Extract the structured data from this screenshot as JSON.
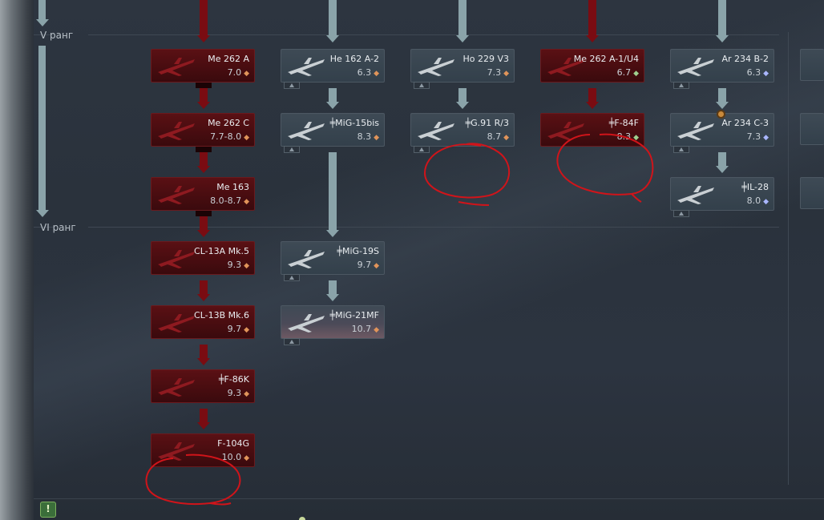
{
  "ranks": [
    {
      "label": "V ранг"
    },
    {
      "label": "VI ранг"
    }
  ],
  "columns": [
    {
      "vehicles": [
        {
          "name": "Me 262 A",
          "br": "7.0",
          "style": "red",
          "br_color": "orange"
        },
        {
          "name": "Me 262 C",
          "br": "7.7-8.0",
          "style": "red",
          "br_color": "orange"
        },
        {
          "name": "Me 163",
          "br": "8.0-8.7",
          "style": "red",
          "br_color": "orange"
        },
        {
          "name": "CL-13A Mk.5",
          "br": "9.3",
          "style": "red",
          "br_color": "orange"
        },
        {
          "name": "CL-13B Mk.6",
          "br": "9.7",
          "style": "red",
          "br_color": "orange"
        },
        {
          "name": "╪F-86K",
          "br": "9.3",
          "style": "red",
          "br_color": "orange"
        },
        {
          "name": "F-104G",
          "br": "10.0",
          "style": "red",
          "br_color": "orange"
        }
      ]
    },
    {
      "vehicles": [
        {
          "name": "He 162 A-2",
          "br": "6.3",
          "style": "dark",
          "br_color": "orange"
        },
        {
          "name": "╪MiG-15bis",
          "br": "8.3",
          "style": "dark",
          "br_color": "orange"
        },
        {
          "name": "╪MiG-19S",
          "br": "9.7",
          "style": "dark",
          "br_color": "orange"
        },
        {
          "name": "╪MiG-21MF",
          "br": "10.7",
          "style": "pink",
          "br_color": "orange"
        }
      ]
    },
    {
      "vehicles": [
        {
          "name": "Ho 229 V3",
          "br": "7.3",
          "style": "dark",
          "br_color": "orange"
        },
        {
          "name": "╪G.91 R/3",
          "br": "8.7",
          "style": "dark",
          "br_color": "orange"
        }
      ]
    },
    {
      "vehicles": [
        {
          "name": "Me 262 A-1/U4",
          "br": "6.7",
          "style": "red",
          "br_color": "green"
        },
        {
          "name": "╪F-84F",
          "br": "8.3",
          "style": "red",
          "br_color": "green"
        }
      ]
    },
    {
      "vehicles": [
        {
          "name": "Ar 234 B-2",
          "br": "6.3",
          "style": "dark",
          "br_color": "blue"
        },
        {
          "name": "Ar 234 C-3",
          "br": "7.3",
          "style": "dark",
          "br_color": "blue"
        },
        {
          "name": "╪IL-28",
          "br": "8.0",
          "style": "dark",
          "br_color": "blue"
        }
      ]
    }
  ],
  "annotations": {
    "circle_color": "#d0141a"
  },
  "icons": {
    "br_marker": "diamond",
    "warning": "exclamation-shield-icon"
  }
}
